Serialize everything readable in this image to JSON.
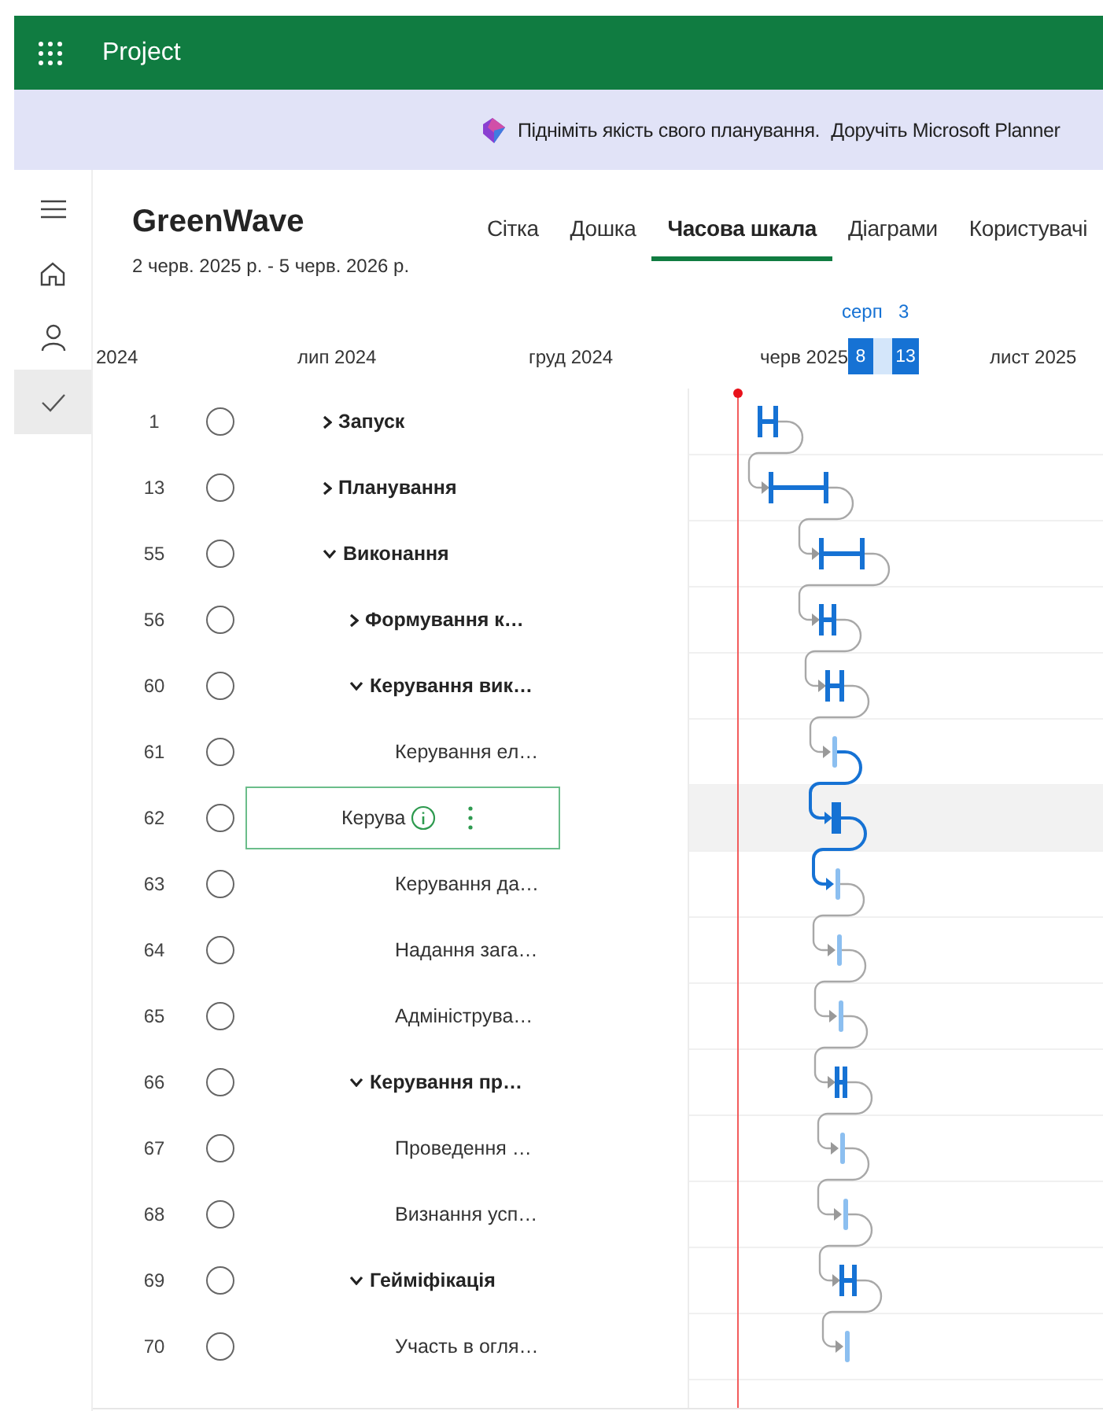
{
  "app": {
    "name": "Project"
  },
  "banner": {
    "message": "Підніміть якість свого планування.",
    "action": "Доручіть Microsoft Planner"
  },
  "rail": [
    {
      "kind": "menu",
      "selected": false
    },
    {
      "kind": "home",
      "selected": false
    },
    {
      "kind": "person",
      "selected": false
    },
    {
      "kind": "tasks",
      "selected": true
    }
  ],
  "project": {
    "title": "GreenWave",
    "dates": "2 черв. 2025 р. - 5 черв. 2026 р."
  },
  "tabs": [
    {
      "label": "Сітка",
      "selected": false
    },
    {
      "label": "Дошка",
      "selected": false
    },
    {
      "label": "Часова шкала",
      "selected": true
    },
    {
      "label": "Діаграми",
      "selected": false
    },
    {
      "label": "Користувачі",
      "selected": false
    }
  ],
  "timeline": {
    "ticks": [
      "2024",
      "лип 2024",
      "груд 2024",
      "черв 2025",
      "лист 2025"
    ],
    "focus": {
      "month": "серп",
      "day": "3",
      "start": "8",
      "end": "13"
    }
  },
  "tasks": [
    {
      "number": "1",
      "name": "Запуск",
      "expanded": false,
      "checked": false,
      "selected": false
    },
    {
      "number": "13",
      "name": "Планування",
      "expanded": false,
      "checked": false,
      "selected": false
    },
    {
      "number": "55",
      "name": "Виконання",
      "expanded": true,
      "checked": false,
      "selected": false,
      "children": [
        {
          "number": "56",
          "name": "Формування к…",
          "expanded": false,
          "checked": false,
          "selected": false
        },
        {
          "number": "60",
          "name": "Керування вик…",
          "expanded": true,
          "checked": false,
          "selected": false,
          "children": [
            {
              "number": "61",
              "name": "Керування ел…",
              "checked": false,
              "selected": false
            },
            {
              "number": "62",
              "name": "Керува",
              "checked": false,
              "selected": true
            },
            {
              "number": "63",
              "name": "Керування да…",
              "checked": false,
              "selected": false
            },
            {
              "number": "64",
              "name": "Надання зага…",
              "checked": false,
              "selected": false
            },
            {
              "number": "65",
              "name": "Адмініструва…",
              "checked": false,
              "selected": false
            }
          ]
        },
        {
          "number": "66",
          "name": "Керування пр…",
          "expanded": true,
          "checked": false,
          "selected": false,
          "children": [
            {
              "number": "67",
              "name": "Проведення …",
              "checked": false,
              "selected": false
            },
            {
              "number": "68",
              "name": "Визнання усп…",
              "checked": false,
              "selected": false
            }
          ]
        },
        {
          "number": "69",
          "name": "Гейміфікація",
          "expanded": true,
          "checked": false,
          "selected": false,
          "children": [
            {
              "number": "70",
              "name": "Участь в огля…",
              "checked": false,
              "selected": false
            }
          ]
        }
      ]
    }
  ]
}
